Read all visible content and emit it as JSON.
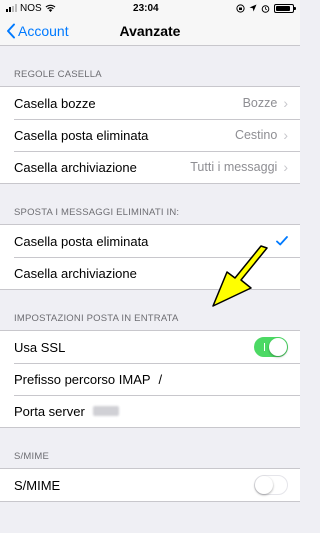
{
  "status_bar": {
    "carrier": "NOS",
    "time": "23:04",
    "battery_level_percent": 90,
    "icons": [
      "signal-icon",
      "wifi-icon",
      "screen-lock-icon",
      "location-icon",
      "alarm-icon",
      "battery-icon"
    ]
  },
  "nav": {
    "back_label": "Account",
    "title": "Avanzate"
  },
  "sections": [
    {
      "header": "REGOLE CASELLA",
      "rows": [
        {
          "label": "Casella bozze",
          "value": "Bozze"
        },
        {
          "label": "Casella posta eliminata",
          "value": "Cestino"
        },
        {
          "label": "Casella archiviazione",
          "value": "Tutti i messaggi"
        }
      ]
    },
    {
      "header": "SPOSTA I MESSAGGI ELIMINATI IN:",
      "rows": [
        {
          "label": "Casella posta eliminata",
          "selected": true
        },
        {
          "label": "Casella archiviazione",
          "selected": false
        }
      ]
    },
    {
      "header": "IMPOSTAZIONI POSTA IN ENTRATA",
      "rows": [
        {
          "label": "Usa SSL",
          "toggle": true
        },
        {
          "label": "Prefisso percorso IMAP",
          "value": "/"
        },
        {
          "label": "Porta server",
          "value": ""
        }
      ]
    },
    {
      "header": "S/MIME",
      "rows": [
        {
          "label": "S/MIME",
          "toggle": false
        }
      ]
    }
  ],
  "colors": {
    "accent": "#007aff",
    "toggle_on": "#4cd964",
    "background": "#efeff4",
    "annotation_arrow": "#ffff00"
  }
}
